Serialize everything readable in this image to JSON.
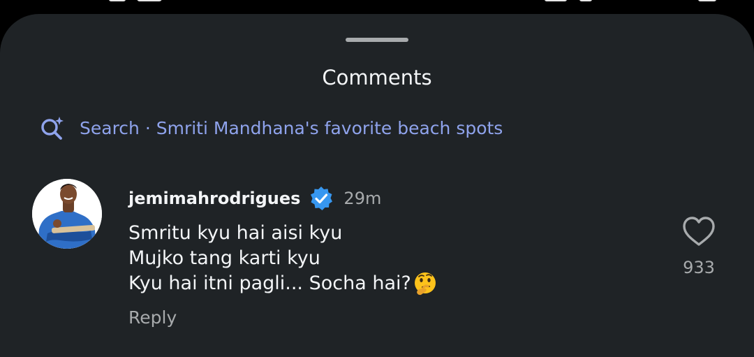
{
  "sheet": {
    "title": "Comments"
  },
  "search": {
    "icon": "search-sparkle-icon",
    "label": "Search · Smriti Mandhana's favorite beach spots",
    "color": "#8fa3ec"
  },
  "comment": {
    "username": "jemimahrodrigues",
    "verified_icon": "verified-badge-icon",
    "verified_color": "#3797f0",
    "timestamp": "29m",
    "lines": [
      "Smritu kyu hai aisi kyu",
      "Mujko tang karti kyu",
      "Kyu hai itni pagli... Socha hai?"
    ],
    "emoji_icon": "thinking-face-icon",
    "reply_label": "Reply",
    "like_icon": "heart-outline-icon",
    "like_count": "933"
  },
  "colors": {
    "background": "#1f2326",
    "primary_text": "#f3f5f7",
    "secondary_text": "#a8abad"
  }
}
